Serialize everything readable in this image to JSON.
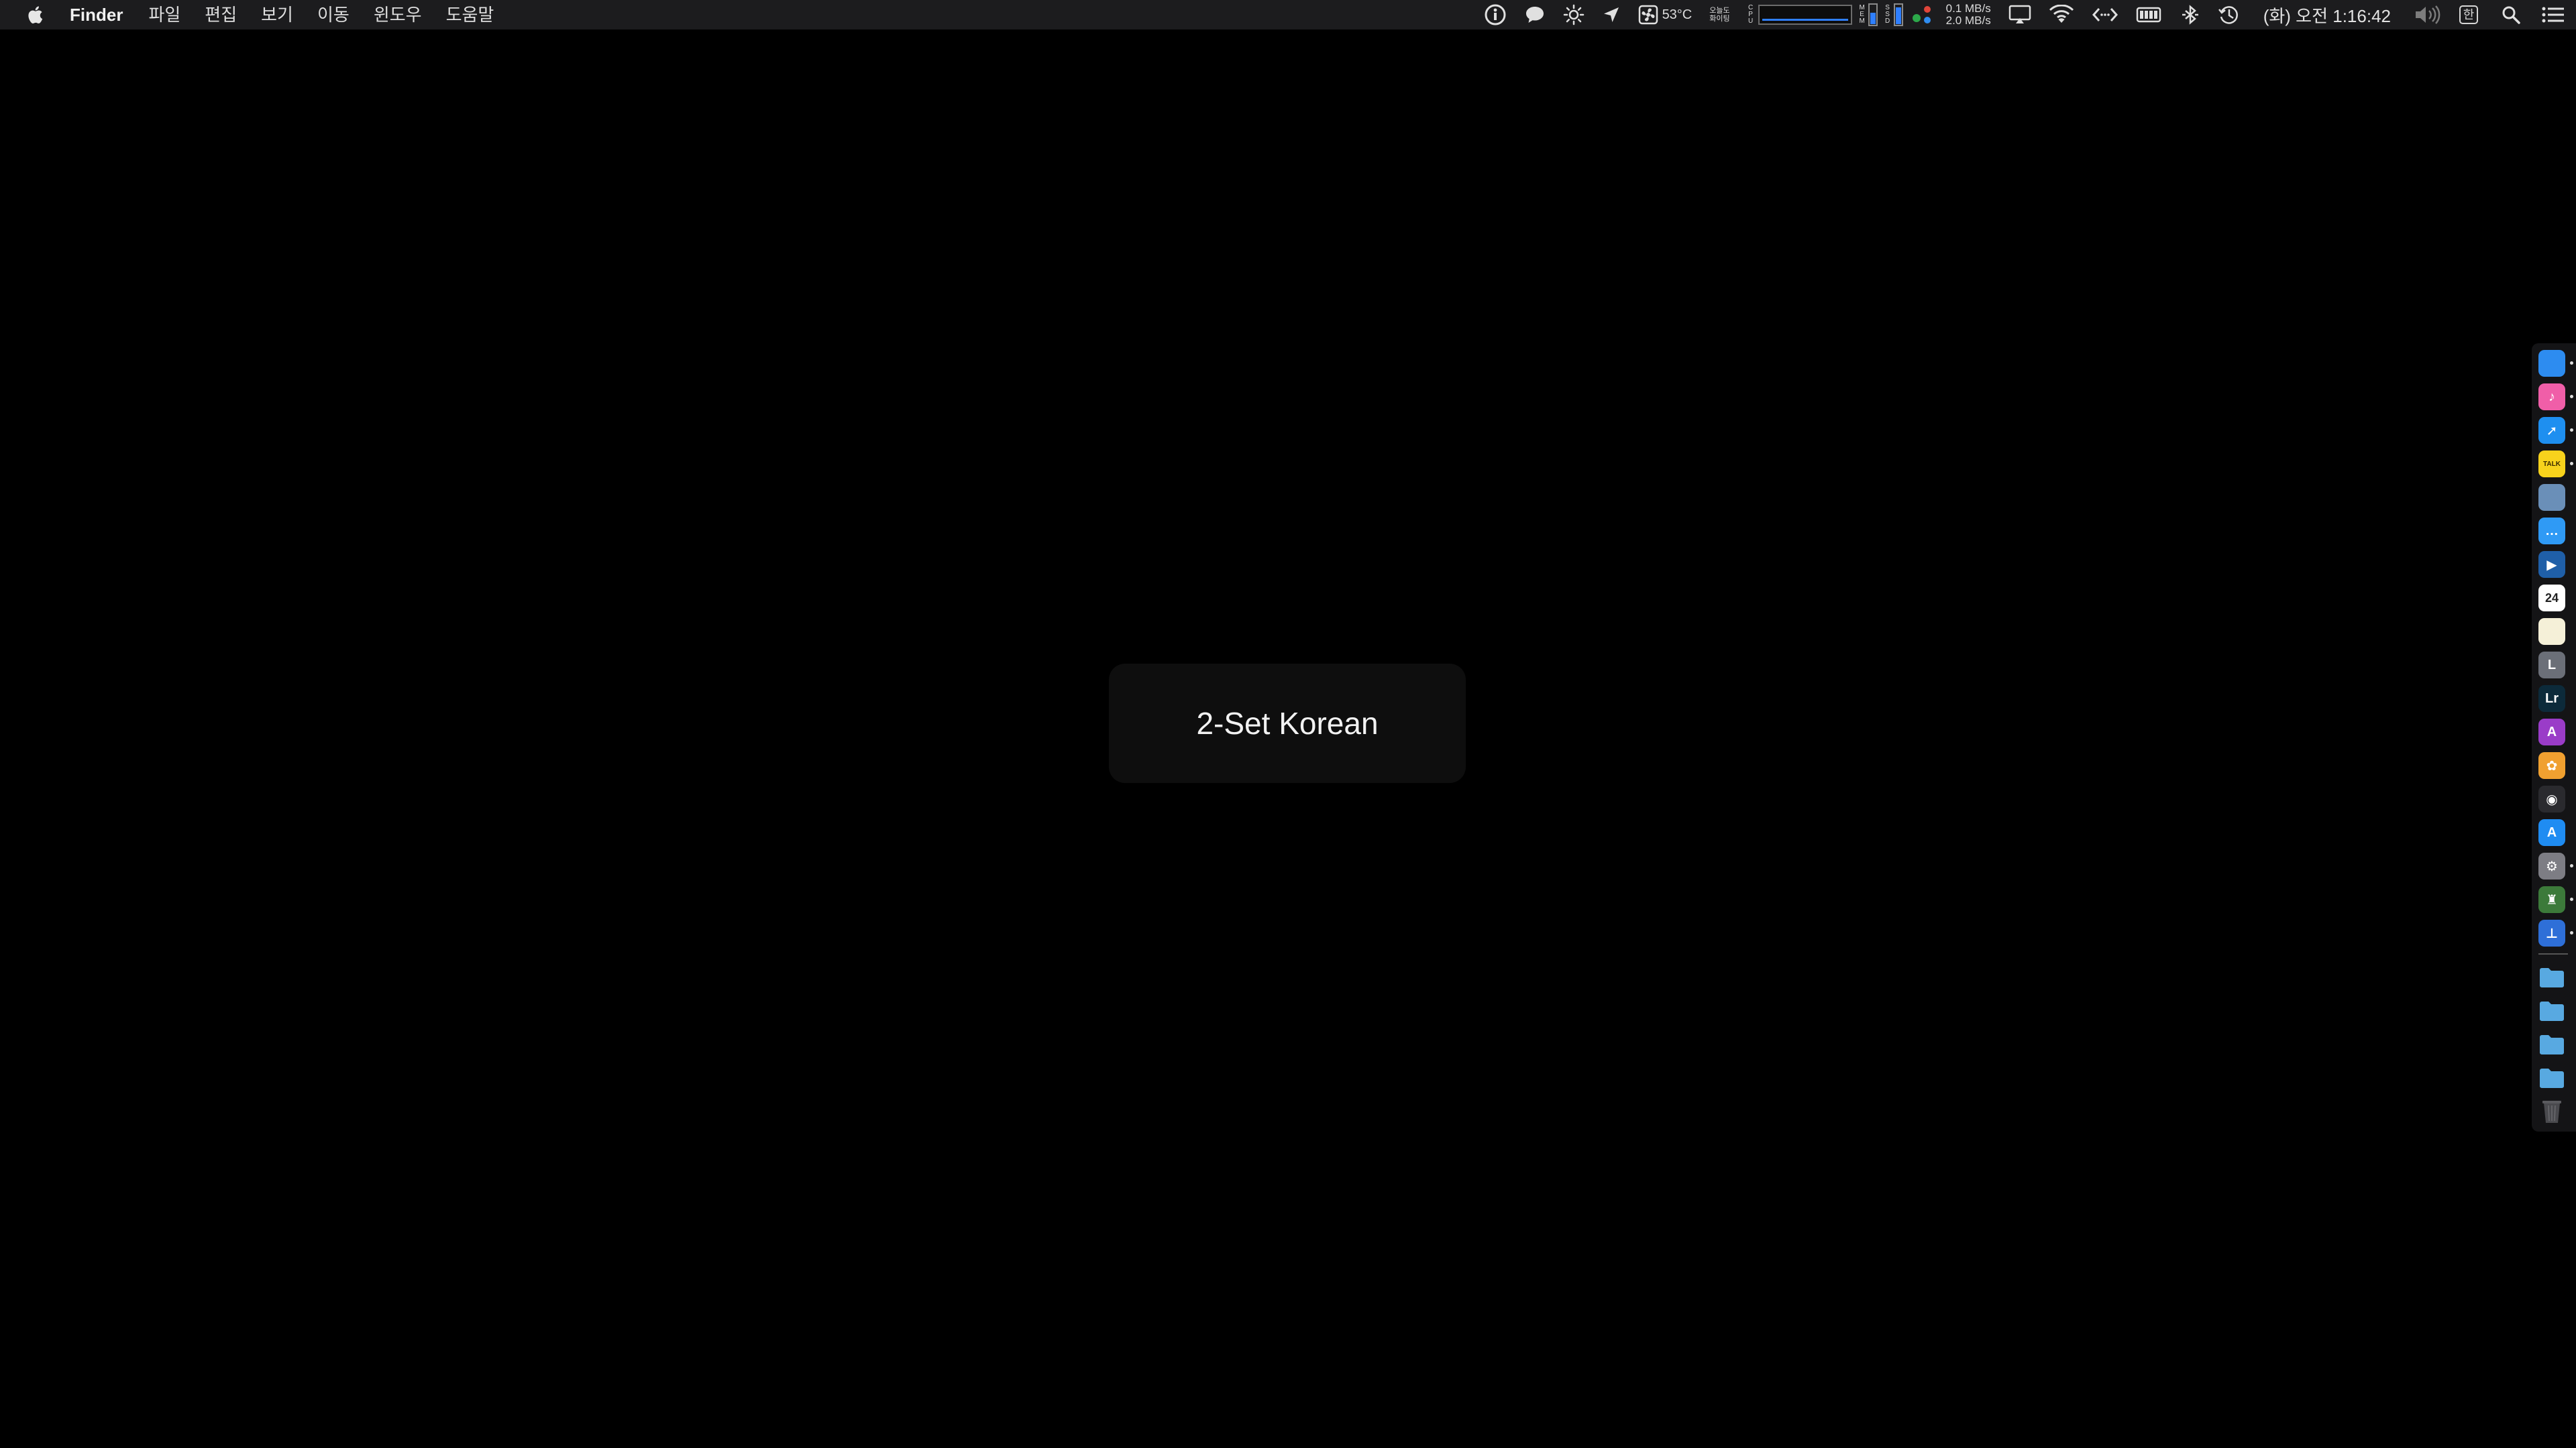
{
  "menubar": {
    "app_name": "Finder",
    "menus": [
      "파일",
      "편집",
      "보기",
      "이동",
      "윈도우",
      "도움말"
    ],
    "status": {
      "temperature": "53°C",
      "tiny_label_top": "오늘도",
      "tiny_label_bottom": "화이팅",
      "cpu_label": [
        "C",
        "P",
        "U"
      ],
      "mem_label": [
        "M",
        "E",
        "M"
      ],
      "ssd_label": [
        "S",
        "S",
        "D"
      ],
      "net_up": "0.1 MB/s",
      "net_down": "2.0 MB/s",
      "clock": "(화) 오전 1:16:42",
      "input_source_badge": "한"
    },
    "icons": [
      "info-icon",
      "message-icon",
      "brightness-icon",
      "location-arrow-icon",
      "fan-icon",
      "airplay-icon",
      "wifi-icon",
      "code-arrows-icon",
      "battery-icon",
      "bluetooth-icon",
      "time-machine-icon",
      "volume-icon",
      "spotlight-search-icon",
      "notification-center-icon"
    ]
  },
  "hud": {
    "input_source": "2-Set Korean"
  },
  "dock": {
    "apps": [
      {
        "icon": "finder-icon",
        "color": "#2d8cf0",
        "running": true,
        "glyph": ""
      },
      {
        "icon": "itunes-icon",
        "color": "#f05ea8",
        "running": true,
        "glyph": "♪"
      },
      {
        "icon": "safari-icon",
        "color": "#1e8ff0",
        "running": true,
        "glyph": "➚"
      },
      {
        "icon": "kakaotalk-icon",
        "color": "#f7d21c",
        "running": true,
        "glyph": "TALK"
      },
      {
        "icon": "preview-icon",
        "color": "#6a8fb8",
        "running": false,
        "glyph": ""
      },
      {
        "icon": "messages-icon",
        "color": "#2f9af5",
        "running": false,
        "glyph": "…"
      },
      {
        "icon": "quicktime-icon",
        "color": "#1f5fa8",
        "running": false,
        "glyph": "▶"
      },
      {
        "icon": "calendar-icon",
        "color": "#ffffff",
        "running": false,
        "glyph": "24"
      },
      {
        "icon": "notes-icon",
        "color": "#f5f0d8",
        "running": false,
        "glyph": ""
      },
      {
        "icon": "script-editor-icon",
        "color": "#6b6f78",
        "running": false,
        "glyph": "L"
      },
      {
        "icon": "lightroom-icon",
        "color": "#0c2a3a",
        "running": false,
        "glyph": "Lr"
      },
      {
        "icon": "affinity-photo-icon",
        "color": "#9a3cc8",
        "running": false,
        "glyph": "A"
      },
      {
        "icon": "photos-icon",
        "color": "#f0a030",
        "running": false,
        "glyph": "✿"
      },
      {
        "icon": "camera-app-icon",
        "color": "#2a2a2e",
        "running": false,
        "glyph": "◉"
      },
      {
        "icon": "app-store-icon",
        "color": "#1f8cf2",
        "running": false,
        "glyph": "A"
      },
      {
        "icon": "system-preferences-icon",
        "color": "#7d7d84",
        "running": true,
        "glyph": "⚙"
      },
      {
        "icon": "game-app-icon",
        "color": "#3c7a3a",
        "running": true,
        "glyph": "♜"
      },
      {
        "icon": "keynote-icon",
        "color": "#2e6fd8",
        "running": true,
        "glyph": "⊥"
      }
    ],
    "folders": [
      {
        "icon": "applications-folder-icon",
        "color": "#58a9e0"
      },
      {
        "icon": "documents-folder-icon",
        "color": "#58a9e0"
      },
      {
        "icon": "downloads-folder-icon",
        "color": "#58a9e0"
      },
      {
        "icon": "screenshots-folder-icon",
        "color": "#58a9e0"
      }
    ],
    "trash": {
      "icon": "trash-icon",
      "color": "#4a4a4e"
    }
  }
}
